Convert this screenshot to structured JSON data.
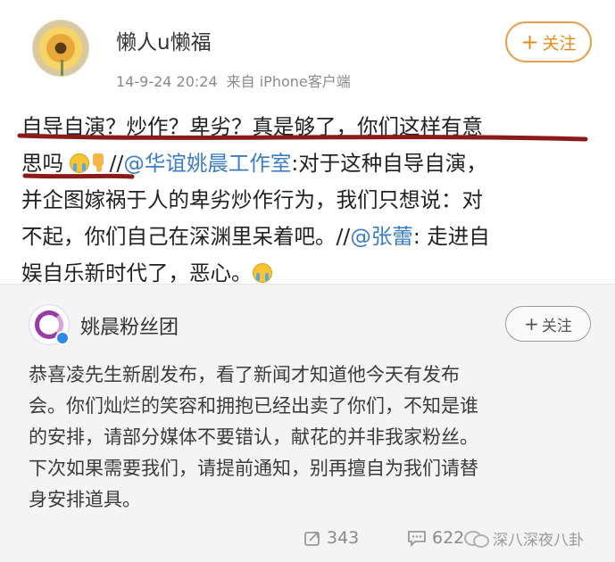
{
  "post": {
    "author": "懒人u懒福",
    "timestamp": "14-9-24 20:24",
    "source": "来自 iPhone客户端",
    "follow_label": "关注",
    "follow_plus": "+",
    "content": {
      "line1": "自导自演？炒作？卑劣？真是够了，你们这样有意",
      "line2_a": "思吗",
      "line2_b": "//",
      "line2_mention": "@华谊姚晨工作室",
      "line2_c": ":对于这种自导自演，",
      "line3": "并企图嫁祸于人的卑劣炒作行为，我们只想说：对",
      "line4_a": "不起，你们自己在深渊里呆着吧。//",
      "line4_mention": "@张蕾",
      "line4_b": ": 走进自",
      "line5": "娱自乐新时代了，恶心。"
    },
    "emojis": [
      "crying-emoji",
      "thumbs-down-emoji",
      "crying-emoji"
    ],
    "underline_color": "#8b1a1a"
  },
  "repost": {
    "author": "姚晨粉丝团",
    "follow_label": "关注",
    "follow_plus": "+",
    "text": {
      "line1": "恭喜凌先生新剧发布，看了新闻才知道他今天有发布",
      "line2": "会。你们灿烂的笑容和拥抱已经出卖了你们，不知是谁",
      "line3": "的安排，请部分媒体不要错认，献花的并非我家粉丝。",
      "line4": "下次如果需要我们，请提前通知，别再擅自为我们请替",
      "line5": "身安排道具。"
    },
    "stats": {
      "reposts": "343",
      "comments": "622"
    },
    "watermark": "深八深夜八卦"
  },
  "colors": {
    "mention": "#3a7cc6",
    "follow_accent": "#e58b1c",
    "repost_bg": "#f4f4f4"
  }
}
